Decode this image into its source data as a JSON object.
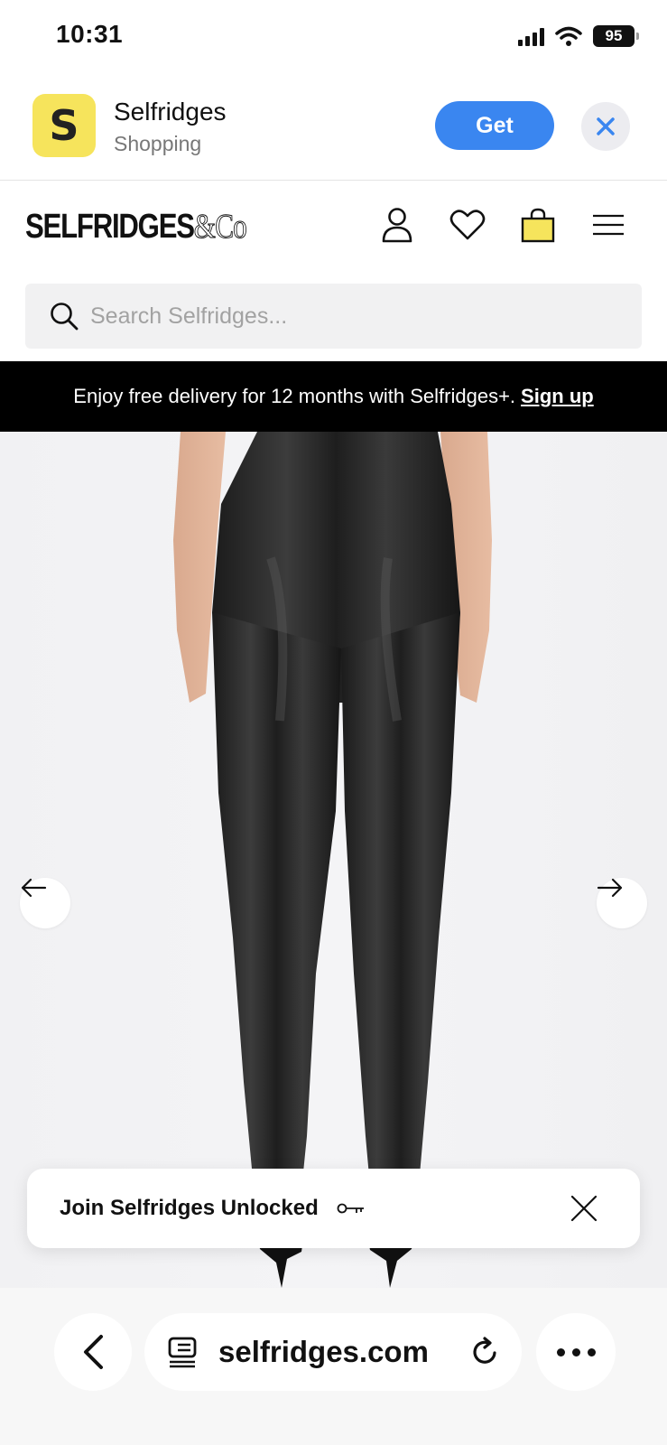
{
  "status_bar": {
    "time": "10:31",
    "battery": "95",
    "icons": [
      "cellular-signal-icon",
      "wifi-icon",
      "battery-icon"
    ]
  },
  "app_banner": {
    "icon_letter": "S",
    "icon_color": "#f6e45c",
    "name": "Selfridges",
    "subtitle": "Shopping",
    "get_label": "Get",
    "get_color": "#3a86f0",
    "close_icon": "close-icon"
  },
  "header": {
    "logo_main": "SELFRIDGES",
    "logo_suffix": "&Co",
    "icons": [
      "account-icon",
      "wishlist-heart-icon",
      "shopping-bag-icon",
      "menu-icon"
    ],
    "bag_color": "#f6e45c"
  },
  "search": {
    "placeholder": "Search Selfridges..."
  },
  "promo": {
    "text": "Enjoy free delivery for 12 months with Selfridges+.",
    "link": "Sign up"
  },
  "product_gallery": {
    "prev_icon": "arrow-left-icon",
    "next_icon": "arrow-right-icon"
  },
  "unlocked": {
    "text": "Join Selfridges Unlocked",
    "key_icon": "key-icon",
    "close_icon": "close-icon"
  },
  "browser": {
    "url": "selfridges.com",
    "icons": [
      "back-chevron-icon",
      "tabs-icon",
      "reload-icon",
      "more-icon"
    ]
  }
}
